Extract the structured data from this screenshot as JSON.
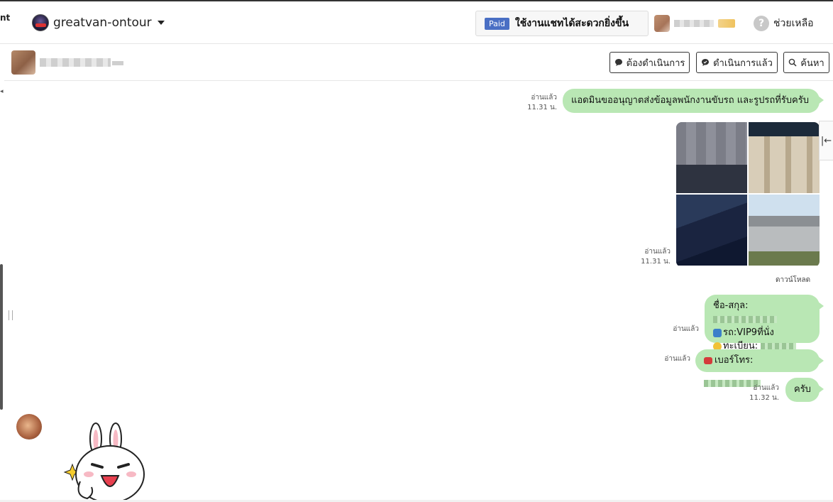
{
  "header": {
    "left_cut_text": "nt",
    "account_name": "greatvan-ontour",
    "paid_badge": "Paid",
    "paid_text": "ใช้งานแชทได้สะดวกยิ่งขึ้น",
    "help_label": "ช่วยเหลือ"
  },
  "chat_header": {
    "buttons": {
      "todo": "ต้องดำเนินการ",
      "done": "ดำเนินการแล้ว",
      "search": "ค้นหา"
    }
  },
  "messages": [
    {
      "status": "อ่านแล้ว",
      "time": "11.31 น.",
      "text": "แอดมินขออนุญาตส่งข้อมูลพนักงานขับรถ และรูปรถที่รับครับ"
    },
    {
      "status": "อ่านแล้ว",
      "time": "11.31 น.",
      "download": "ดาวน์โหลด"
    },
    {
      "status": "อ่านแล้ว",
      "line1": "ชื่อ-สกุล:",
      "line2": "รถ:VIP9ที่นั่ง",
      "line3": "ทะเบียน:"
    },
    {
      "status": "อ่านแล้ว",
      "text": "เบอร์โทร:"
    },
    {
      "status": "อ่านแล้ว",
      "time": "11.32 น.",
      "text": "ครับ"
    }
  ],
  "icons": {
    "help": "question-circle-icon",
    "todo": "speech-bubble-icon",
    "done": "speech-bubble-check-icon",
    "search": "magnifier-icon",
    "collapse": "arrow-left-bar-icon"
  },
  "colors": {
    "bubble": "#b9e7b4",
    "paid_badge": "#4a6fc4"
  }
}
